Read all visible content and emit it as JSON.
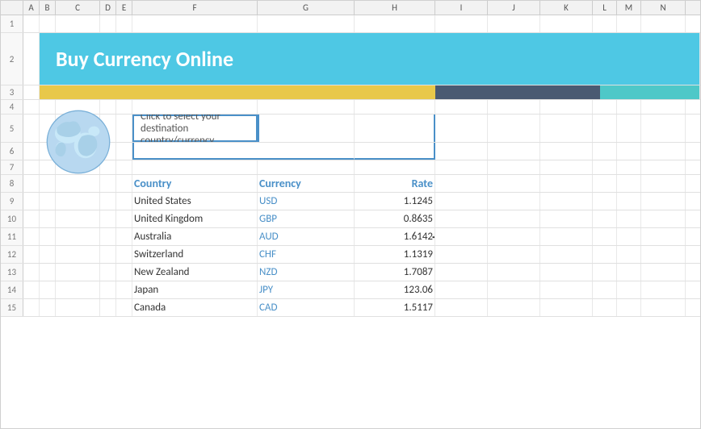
{
  "spreadsheet": {
    "title": "Buy Currency Online",
    "col_headers": [
      "",
      "A",
      "B",
      "C",
      "D",
      "E",
      "F",
      "G",
      "H",
      "I",
      "J",
      "K",
      "L",
      "M",
      "N"
    ],
    "row_numbers": [
      "1",
      "2",
      "3",
      "4",
      "5",
      "6",
      "7",
      "8",
      "9",
      "10",
      "11",
      "12",
      "13",
      "14",
      "15"
    ],
    "banner_text": "Buy Currency Online",
    "select_placeholder": "Click to select your destination country/currency",
    "table": {
      "headers": {
        "country": "Country",
        "currency": "Currency",
        "rate": "Rate"
      },
      "rows": [
        {
          "country": "United States",
          "currency": "USD",
          "rate": "1.1245"
        },
        {
          "country": "United Kingdom",
          "currency": "GBP",
          "rate": "0.8635"
        },
        {
          "country": "Australia",
          "currency": "AUD",
          "rate": "1.6142"
        },
        {
          "country": "Switzerland",
          "currency": "CHF",
          "rate": "1.1319"
        },
        {
          "country": "New Zealand",
          "currency": "NZD",
          "rate": "1.7087"
        },
        {
          "country": "Japan",
          "currency": "JPY",
          "rate": "123.06"
        },
        {
          "country": "Canada",
          "currency": "CAD",
          "rate": "1.5117"
        }
      ]
    }
  }
}
